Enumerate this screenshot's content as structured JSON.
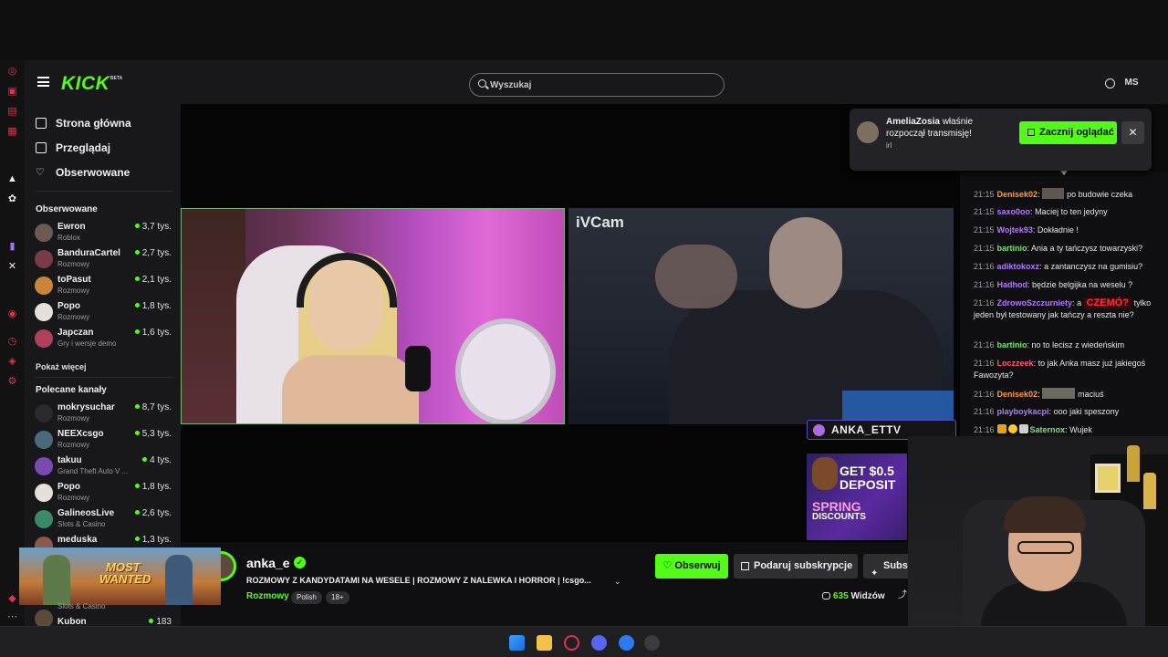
{
  "app": {
    "logo": "KICK",
    "logo_badge": "BETA"
  },
  "header": {
    "search_placeholder": "Wyszukaj",
    "avatar": "MS"
  },
  "nav": [
    {
      "label": "Strona główna",
      "icon": "home-icon"
    },
    {
      "label": "Przeglądaj",
      "icon": "browse-icon"
    },
    {
      "label": "Obserwowane",
      "icon": "heart-icon"
    }
  ],
  "followed": {
    "title": "Obserwowane",
    "channels": [
      {
        "name": "Ewron",
        "category": "Roblox",
        "viewers": "3,7 tys."
      },
      {
        "name": "BanduraCartel",
        "category": "Rozmowy",
        "viewers": "2,7 tys."
      },
      {
        "name": "toPasut",
        "category": "Rozmowy",
        "viewers": "2,1 tys."
      },
      {
        "name": "Popo",
        "category": "Rozmowy",
        "viewers": "1,8 tys."
      },
      {
        "name": "Japczan",
        "category": "Gry i wersje demo",
        "viewers": "1,6 tys."
      }
    ],
    "show_more": "Pokaż więcej"
  },
  "recommended": {
    "title": "Polecane kanały",
    "channels": [
      {
        "name": "mokrysuchar",
        "category": "Rozmowy",
        "viewers": "8,7 tys."
      },
      {
        "name": "NEEXcsgo",
        "category": "Rozmowy",
        "viewers": "5,3 tys."
      },
      {
        "name": "takuu",
        "category": "Grand Theft Auto V ...",
        "viewers": "4 tys."
      },
      {
        "name": "Popo",
        "category": "Rozmowy",
        "viewers": "1,8 tys."
      },
      {
        "name": "GalineosLive",
        "category": "Slots & Casino",
        "viewers": "2,6 tys."
      },
      {
        "name": "meduska",
        "category": "",
        "viewers": "1,3 tys."
      },
      {
        "name": "Kubon",
        "category": "",
        "viewers": "183"
      }
    ],
    "hidden_category": "Slots & Casino"
  },
  "stream": {
    "cam_label": "iVCam",
    "overlay_handle": "ANKA_ETTV",
    "ad": {
      "line1": "GET $0.5",
      "line2": "DEPOSIT",
      "line3": "SPRING",
      "line4": "DISCOUNTS"
    },
    "channel": "anka_e",
    "title": "ROZMOWY Z KANDYDATAMI NA WESELE | ROZMOWY Z NALEWKA I HORROR | !csgo...",
    "category": "Rozmowy",
    "tags": [
      "Polish",
      "18+"
    ],
    "follow_label": "Obserwuj",
    "gift_label": "Podaruj subskrypcje",
    "sub_label": "Subs",
    "viewers_count": "635",
    "viewers_label": "Widzów"
  },
  "thumbnail": {
    "line1": "MOST",
    "line2": "WANTED"
  },
  "toast": {
    "user": "AmeliaZosia",
    "text": "właśnie rozpoczął transmisję!",
    "category": "irl",
    "button": "Zacznij oglądać",
    "close": "✕"
  },
  "chat": [
    {
      "time": "21:15",
      "user": "Denisek02",
      "color": "#ff9a3c",
      "emote": true,
      "text": "po budowie czeka"
    },
    {
      "time": "21:15",
      "user": "saxo0oo",
      "color": "#b57aff",
      "text": "Maciej to ten jedyny"
    },
    {
      "time": "21:15",
      "user": "Wojtek93",
      "color": "#b57aff",
      "text": "Dokładnie !"
    },
    {
      "time": "21:15",
      "user": "bartinio",
      "color": "#7ee07a",
      "text": "Ania a ty tańczysz towarzyski?"
    },
    {
      "time": "21:16",
      "user": "adiktokoxz",
      "color": "#b57aff",
      "text": "a zantanczysz na gumisiu?"
    },
    {
      "time": "21:16",
      "user": "Hadhod",
      "color": "#b57aff",
      "text": "będzie belgijka na weselu ?"
    },
    {
      "time": "21:16",
      "user": "ZdrowoSzczurniety",
      "color": "#b57aff",
      "text": "a",
      "emote_text": "CZEMÓ?",
      "text2": "tylko jeden był testowany jak tańczy a reszta nie?"
    },
    {
      "time": "21:16",
      "user": "bartinio",
      "color": "#7ee07a",
      "text": "no to lecisz z wiedeńskim"
    },
    {
      "time": "21:16",
      "user": "Loczzeek",
      "color": "#ff5a7a",
      "text": "to jak Anka masz już jakiegoś Fawozyta?"
    },
    {
      "time": "21:16",
      "user": "Denisek02",
      "color": "#ff9a3c",
      "emote": true,
      "text": "maciuś"
    },
    {
      "time": "21:16",
      "user": "playboykacpi",
      "color": "#b57aff",
      "text": "ooo jaki speszony"
    },
    {
      "time": "21:16",
      "user": "Saternox",
      "color": "#7ee07a",
      "badges": true,
      "text": "Wujek"
    }
  ],
  "colors": {
    "brand": "#53fc18",
    "background": "#0f0f11",
    "sidebar": "#18181b"
  }
}
